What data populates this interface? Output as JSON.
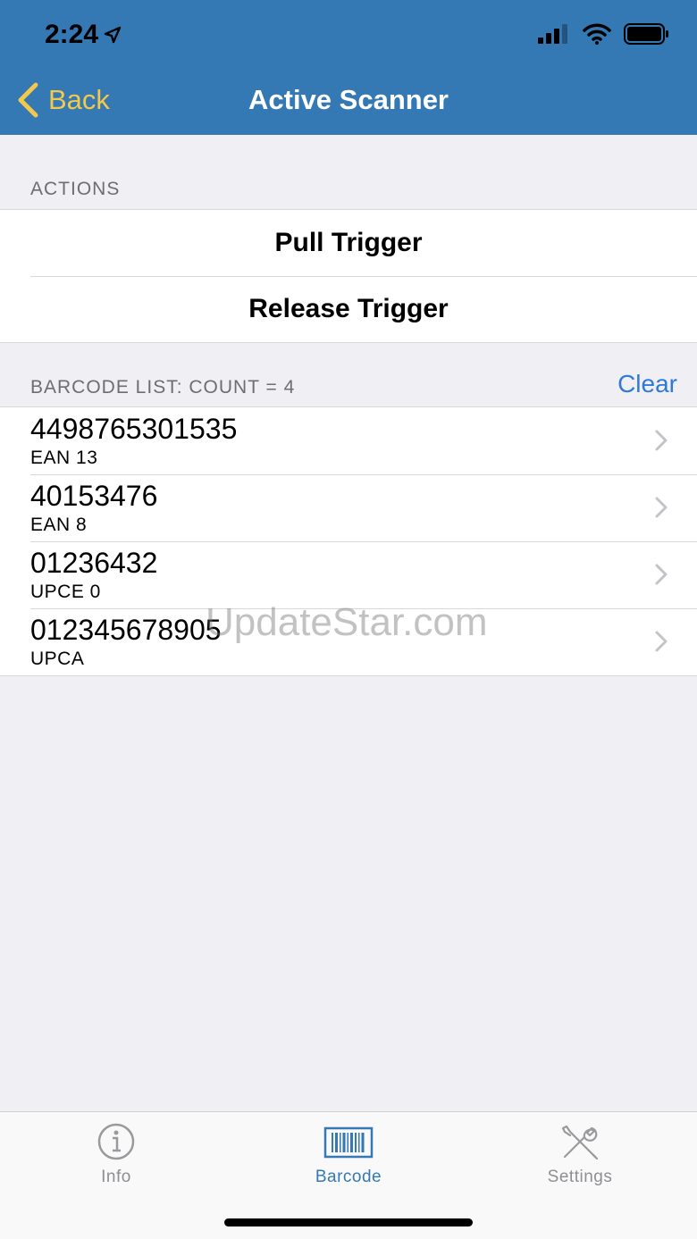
{
  "status": {
    "time": "2:24"
  },
  "nav": {
    "back_label": "Back",
    "title": "Active Scanner"
  },
  "actions": {
    "header": "ACTIONS",
    "items": [
      {
        "label": "Pull Trigger"
      },
      {
        "label": "Release Trigger"
      }
    ]
  },
  "barcodes": {
    "header": "BARCODE LIST: COUNT = 4",
    "clear_label": "Clear",
    "items": [
      {
        "value": "4498765301535",
        "type": "EAN 13"
      },
      {
        "value": "40153476",
        "type": "EAN 8"
      },
      {
        "value": "01236432",
        "type": "UPCE 0"
      },
      {
        "value": "012345678905",
        "type": "UPCA"
      }
    ]
  },
  "watermark": "UpdateStar.com",
  "tabs": [
    {
      "label": "Info",
      "icon": "info-icon",
      "active": false
    },
    {
      "label": "Barcode",
      "icon": "barcode-icon",
      "active": true
    },
    {
      "label": "Settings",
      "icon": "settings-tools-icon",
      "active": false
    }
  ],
  "colors": {
    "header_bg": "#3478b4",
    "back_accent": "#f2c94c",
    "link_blue": "#2f7ad8",
    "background": "#efeff4"
  }
}
